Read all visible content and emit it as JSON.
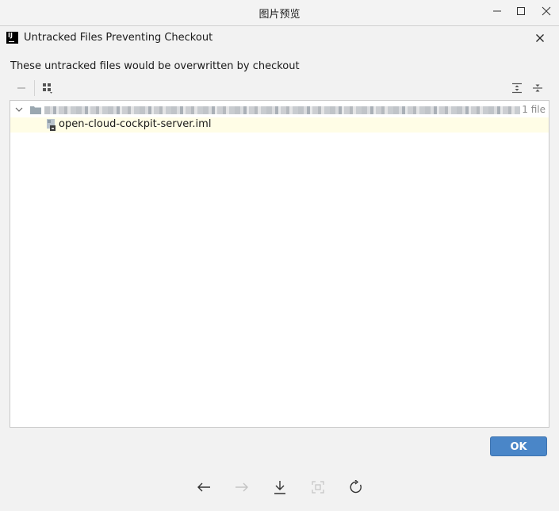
{
  "viewer": {
    "title": "图片预览"
  },
  "dialog": {
    "title": "Untracked Files Preventing Checkout",
    "app_icon_text": "IJ",
    "message": "These untracked files would be overwritten by checkout",
    "tree": {
      "root_count": "1 file",
      "file_name": "open-cloud-cockpit-server.iml"
    },
    "ok_label": "OK"
  },
  "colors": {
    "accent": "#4a86c8",
    "selected_row": "#fffde6"
  }
}
